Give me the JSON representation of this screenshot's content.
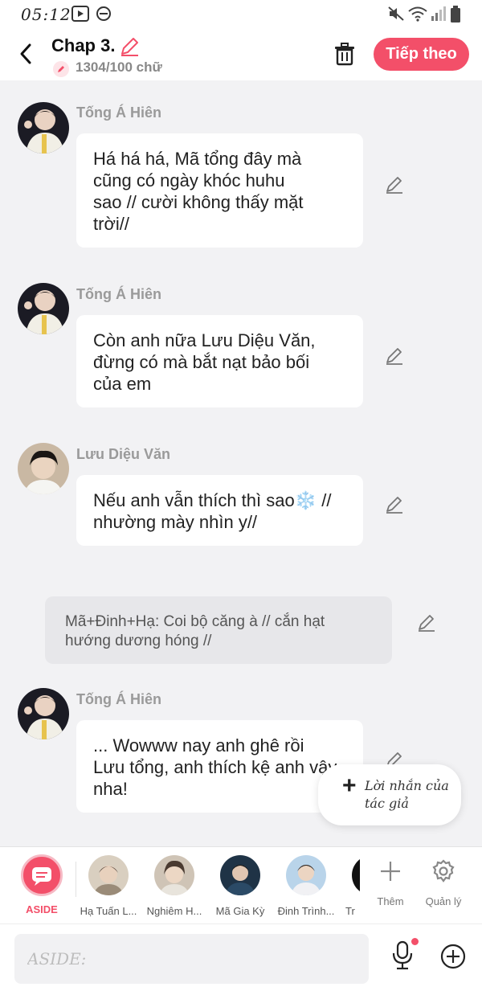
{
  "status": {
    "time": "05:12"
  },
  "header": {
    "title": "Chap 3.",
    "word_count": "1304/100 chữ",
    "next_label": "Tiếp theo"
  },
  "messages": [
    {
      "name": "Tống Á Hiên",
      "lines": [
        "Há há há, Mã tổng đây mà",
        "cũng có ngày khóc huhu",
        "sao // cười không thấy mặt",
        "trời//"
      ]
    },
    {
      "name": "Tống Á Hiên",
      "lines": [
        "Còn anh nữa Lưu Diệu Văn,",
        "đừng có mà bắt nạt bảo bối",
        "của em"
      ]
    },
    {
      "name": "Lưu Diệu Văn",
      "lines": [
        "Nếu anh vẫn thích thì sao❄️ //",
        "nhường mày nhìn y//"
      ]
    },
    {
      "name": "Tống Á Hiên",
      "lines": [
        "... Wowww nay anh ghê rồi",
        "Lưu tổng, anh thích kệ anh vậy",
        "nha!"
      ]
    }
  ],
  "aside_message": {
    "lines": [
      "Mã+Đinh+Hạ: Coi bộ căng à // cắn hạt",
      "hướng dương hóng //"
    ]
  },
  "author_note": {
    "label": "Lời nhắn của tác giả"
  },
  "character_bar": {
    "aside_label": "ASIDE",
    "characters": [
      {
        "name": "Hạ Tuấn L..."
      },
      {
        "name": "Nghiêm H..."
      },
      {
        "name": "Mã Gia Kỳ"
      },
      {
        "name": "Đinh Trình..."
      },
      {
        "name": "Tr"
      }
    ],
    "add_label": "Thêm",
    "manage_label": "Quản lý"
  },
  "input": {
    "placeholder": "ASIDE:"
  },
  "colors": {
    "accent": "#f34f69",
    "background": "#f2f2f4"
  }
}
